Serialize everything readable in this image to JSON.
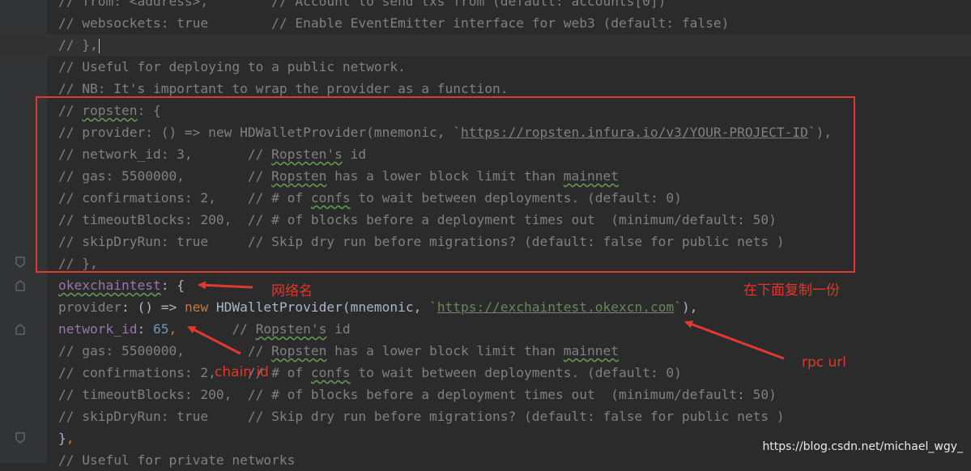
{
  "editor": {
    "lines": [
      {
        "id": "l0",
        "segments": [
          {
            "t": "// from: <address>,        // Account to send txs from (default: accounts[0])",
            "c": "cm"
          }
        ]
      },
      {
        "id": "l1",
        "segments": [
          {
            "t": "// websockets: true        // Enable EventEmitter interface for web3 (default: false)",
            "c": "cm"
          }
        ]
      },
      {
        "id": "l2",
        "segments": [
          {
            "t": "// },",
            "c": "cm"
          }
        ],
        "current": true
      },
      {
        "id": "l3",
        "segments": [
          {
            "t": "// Useful for deploying to a public network.",
            "c": "cm"
          }
        ]
      },
      {
        "id": "l4",
        "segments": [
          {
            "t": "// NB: It's important to wrap the provider as a function.",
            "c": "cm"
          }
        ]
      },
      {
        "id": "l5",
        "segments": [
          {
            "t": "// ",
            "c": "cm"
          },
          {
            "t": "ropsten",
            "c": "cm sq"
          },
          {
            "t": ": {",
            "c": "cm"
          }
        ]
      },
      {
        "id": "l6",
        "segments": [
          {
            "t": "// provider: () => new HDWalletProvider(mnemonic, `",
            "c": "cm"
          },
          {
            "t": "https://ropsten.infura.io/v3/YOUR-PROJECT-ID",
            "c": "cm u"
          },
          {
            "t": "`),",
            "c": "cm"
          }
        ]
      },
      {
        "id": "l7",
        "segments": [
          {
            "t": "// network_id: 3,       // ",
            "c": "cm"
          },
          {
            "t": "Ropsten's",
            "c": "cm sq"
          },
          {
            "t": " id",
            "c": "cm"
          }
        ]
      },
      {
        "id": "l8",
        "segments": [
          {
            "t": "// gas: 5500000,        // ",
            "c": "cm"
          },
          {
            "t": "Ropsten",
            "c": "cm sq"
          },
          {
            "t": " has a lower block limit than ",
            "c": "cm"
          },
          {
            "t": "mainnet",
            "c": "cm sq"
          }
        ]
      },
      {
        "id": "l9",
        "segments": [
          {
            "t": "// confirmations: 2,    // # of ",
            "c": "cm"
          },
          {
            "t": "confs",
            "c": "cm sq"
          },
          {
            "t": " to wait between deployments. (default: 0)",
            "c": "cm"
          }
        ]
      },
      {
        "id": "l10",
        "segments": [
          {
            "t": "// timeoutBlocks: 200,  // # of blocks before a deployment times out  (minimum/default: 50)",
            "c": "cm"
          }
        ]
      },
      {
        "id": "l11",
        "segments": [
          {
            "t": "// skipDryRun: true     // Skip dry run before migrations? (default: false for public nets )",
            "c": "cm"
          }
        ]
      },
      {
        "id": "l12",
        "segments": [
          {
            "t": "// },",
            "c": "cm"
          }
        ]
      },
      {
        "id": "l13",
        "segments": [
          {
            "t": "okexchaintest",
            "c": "prop sq"
          },
          {
            "t": ": {",
            "c": "txt"
          }
        ]
      },
      {
        "id": "l14",
        "segments": [
          {
            "t": "provider",
            "c": "cm"
          },
          {
            "t": ": () => ",
            "c": "txt"
          },
          {
            "t": "new ",
            "c": "kw"
          },
          {
            "t": "HDWalletProvider",
            "c": "fn"
          },
          {
            "t": "(mnemonic, ",
            "c": "txt"
          },
          {
            "t": "`",
            "c": "str"
          },
          {
            "t": "https://exchaintest.okexcn.com",
            "c": "str u"
          },
          {
            "t": "`",
            "c": "str"
          },
          {
            "t": "),",
            "c": "txt"
          }
        ]
      },
      {
        "id": "l15",
        "segments": [
          {
            "t": "network_id",
            "c": "prop"
          },
          {
            "t": ": ",
            "c": "txt"
          },
          {
            "t": "65",
            "c": "num"
          },
          {
            "t": ",",
            "c": "kw"
          },
          {
            "t": "       // ",
            "c": "cm"
          },
          {
            "t": "Ropsten's",
            "c": "cm sq"
          },
          {
            "t": " id",
            "c": "cm"
          }
        ]
      },
      {
        "id": "l16",
        "segments": [
          {
            "t": "// gas: 5500000,        // ",
            "c": "cm"
          },
          {
            "t": "Ropsten",
            "c": "cm sq"
          },
          {
            "t": " has a lower block limit than ",
            "c": "cm"
          },
          {
            "t": "mainnet",
            "c": "cm sq"
          }
        ]
      },
      {
        "id": "l17",
        "segments": [
          {
            "t": "// confirmations: 2,    // # of ",
            "c": "cm"
          },
          {
            "t": "confs",
            "c": "cm sq"
          },
          {
            "t": " to wait between deployments. (default: 0)",
            "c": "cm"
          }
        ]
      },
      {
        "id": "l18",
        "segments": [
          {
            "t": "// timeoutBlocks: 200,  // # of blocks before a deployment times out  (minimum/default: 50)",
            "c": "cm"
          }
        ]
      },
      {
        "id": "l19",
        "segments": [
          {
            "t": "// skipDryRun: true     // Skip dry run before migrations? (default: false for public nets )",
            "c": "cm"
          }
        ]
      },
      {
        "id": "l20",
        "segments": [
          {
            "t": "}",
            "c": "txt"
          },
          {
            "t": ",",
            "c": "kw"
          }
        ]
      },
      {
        "id": "l21",
        "segments": [
          {
            "t": "// Useful for private networks",
            "c": "cm"
          }
        ]
      }
    ]
  },
  "annotations": {
    "network_name": "网络名",
    "copy_below": "在下面复制一份",
    "rpc_url": "rpc url",
    "chain_id": "chain id"
  },
  "icons": {
    "gutter_hint": "lightbulb-icon",
    "fold": "fold-marker-icon"
  },
  "colors": {
    "background": "#2b2b2b",
    "comment": "#808080",
    "keyword": "#cc7832",
    "property": "#9876aa",
    "number": "#6897bb",
    "string": "#6a8759",
    "annotation_red": "#e03a2e"
  },
  "watermark": "https://blog.csdn.net/michael_wgy_"
}
